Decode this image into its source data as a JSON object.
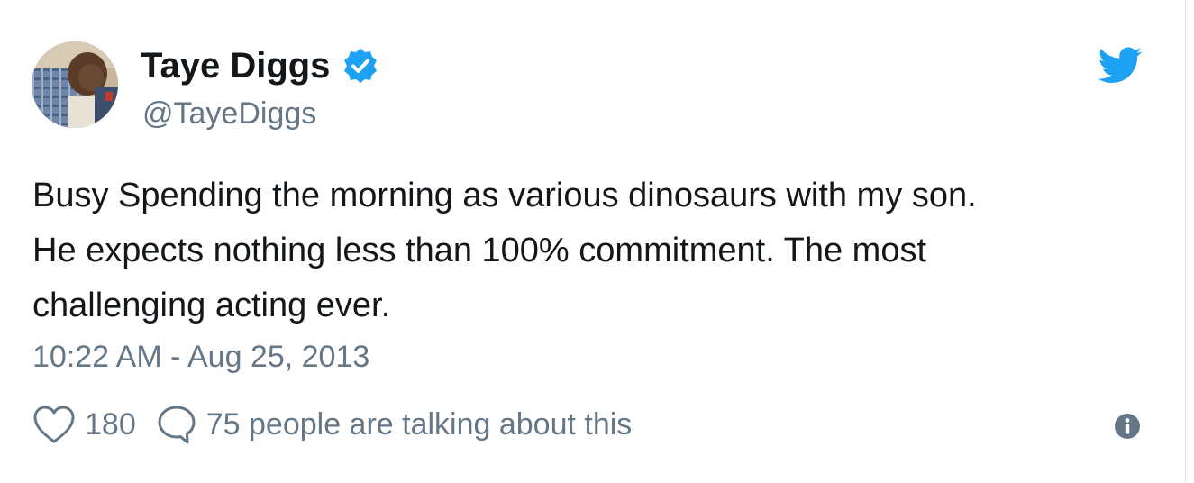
{
  "tweet": {
    "author": {
      "display_name": "Taye Diggs",
      "handle": "@TayeDiggs",
      "verified": true
    },
    "text_lines": [
      "Busy Spending the morning as various dinosaurs with my son.",
      "He expects nothing less than 100% commitment. The most",
      "challenging acting ever."
    ],
    "timestamp": "10:22 AM - Aug 25, 2013",
    "actions": {
      "like_count": "180",
      "talking_text": "75 people are talking about this"
    }
  },
  "icons": {
    "verified": "verified-badge-icon",
    "brand": "twitter-bird-icon",
    "like": "heart-icon",
    "reply": "speech-bubble-icon",
    "info": "info-icon"
  },
  "colors": {
    "brand_blue": "#1da1f2",
    "text_primary": "#14171a",
    "text_secondary": "#657786"
  }
}
